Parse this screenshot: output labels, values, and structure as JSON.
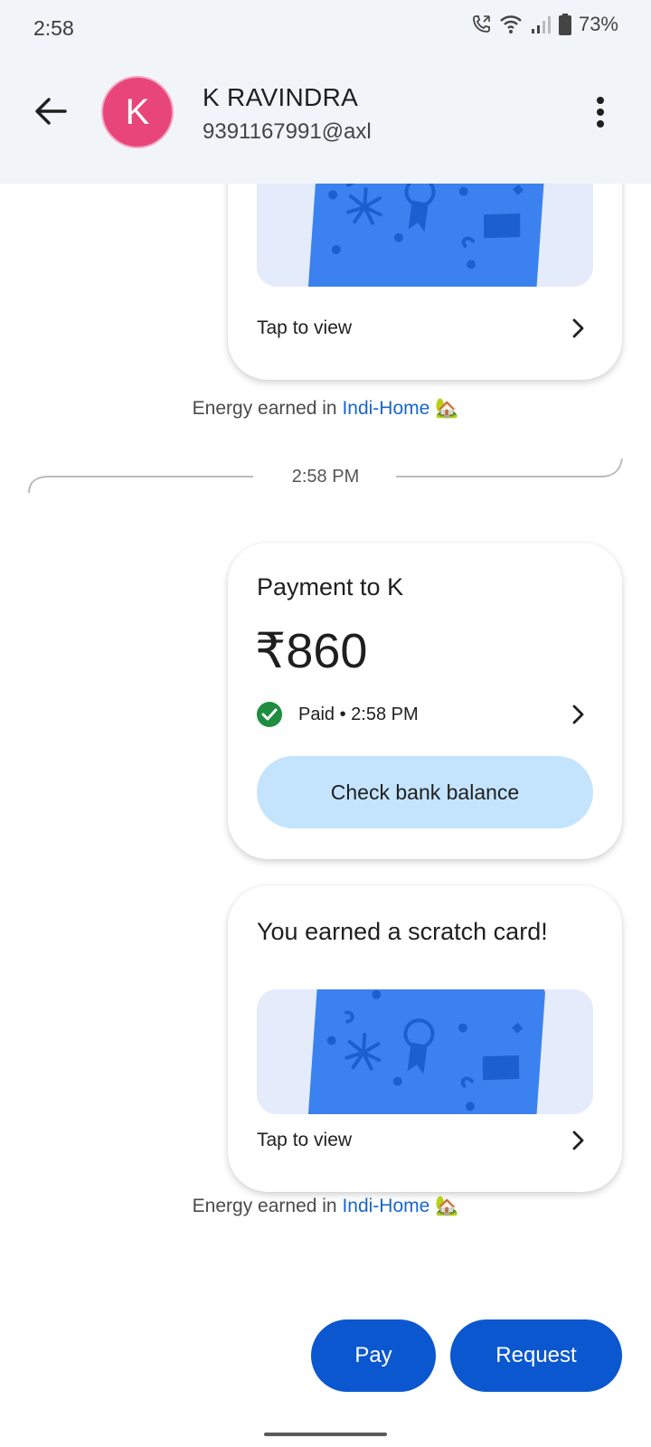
{
  "status_bar": {
    "time": "2:58",
    "battery": "73%",
    "icons": [
      "call-icon",
      "wifi-icon",
      "signal-icon",
      "battery-icon"
    ]
  },
  "header": {
    "avatar_letter": "K",
    "name": "K RAVINDRA",
    "upi_id": "9391167991@axl",
    "avatar_color": "#e8457b"
  },
  "chat": {
    "top_scratch_card": {
      "tap_label": "Tap to view"
    },
    "energy_1": {
      "prefix": "Energy earned in ",
      "link": "Indi-Home",
      "emoji": "🏡"
    },
    "divider_time": "2:58 PM",
    "payment_card": {
      "title": "Payment to K",
      "amount": "₹860",
      "status": "Paid • 2:58 PM",
      "button_label": "Check bank balance"
    },
    "scratch_card": {
      "title": "You earned a scratch card!",
      "tap_label": "Tap to view"
    },
    "energy_2": {
      "prefix": "Energy earned in ",
      "link": "Indi-Home",
      "emoji": "🏡"
    }
  },
  "actions": {
    "pay_label": "Pay",
    "request_label": "Request",
    "accent": "#0b57d0"
  }
}
